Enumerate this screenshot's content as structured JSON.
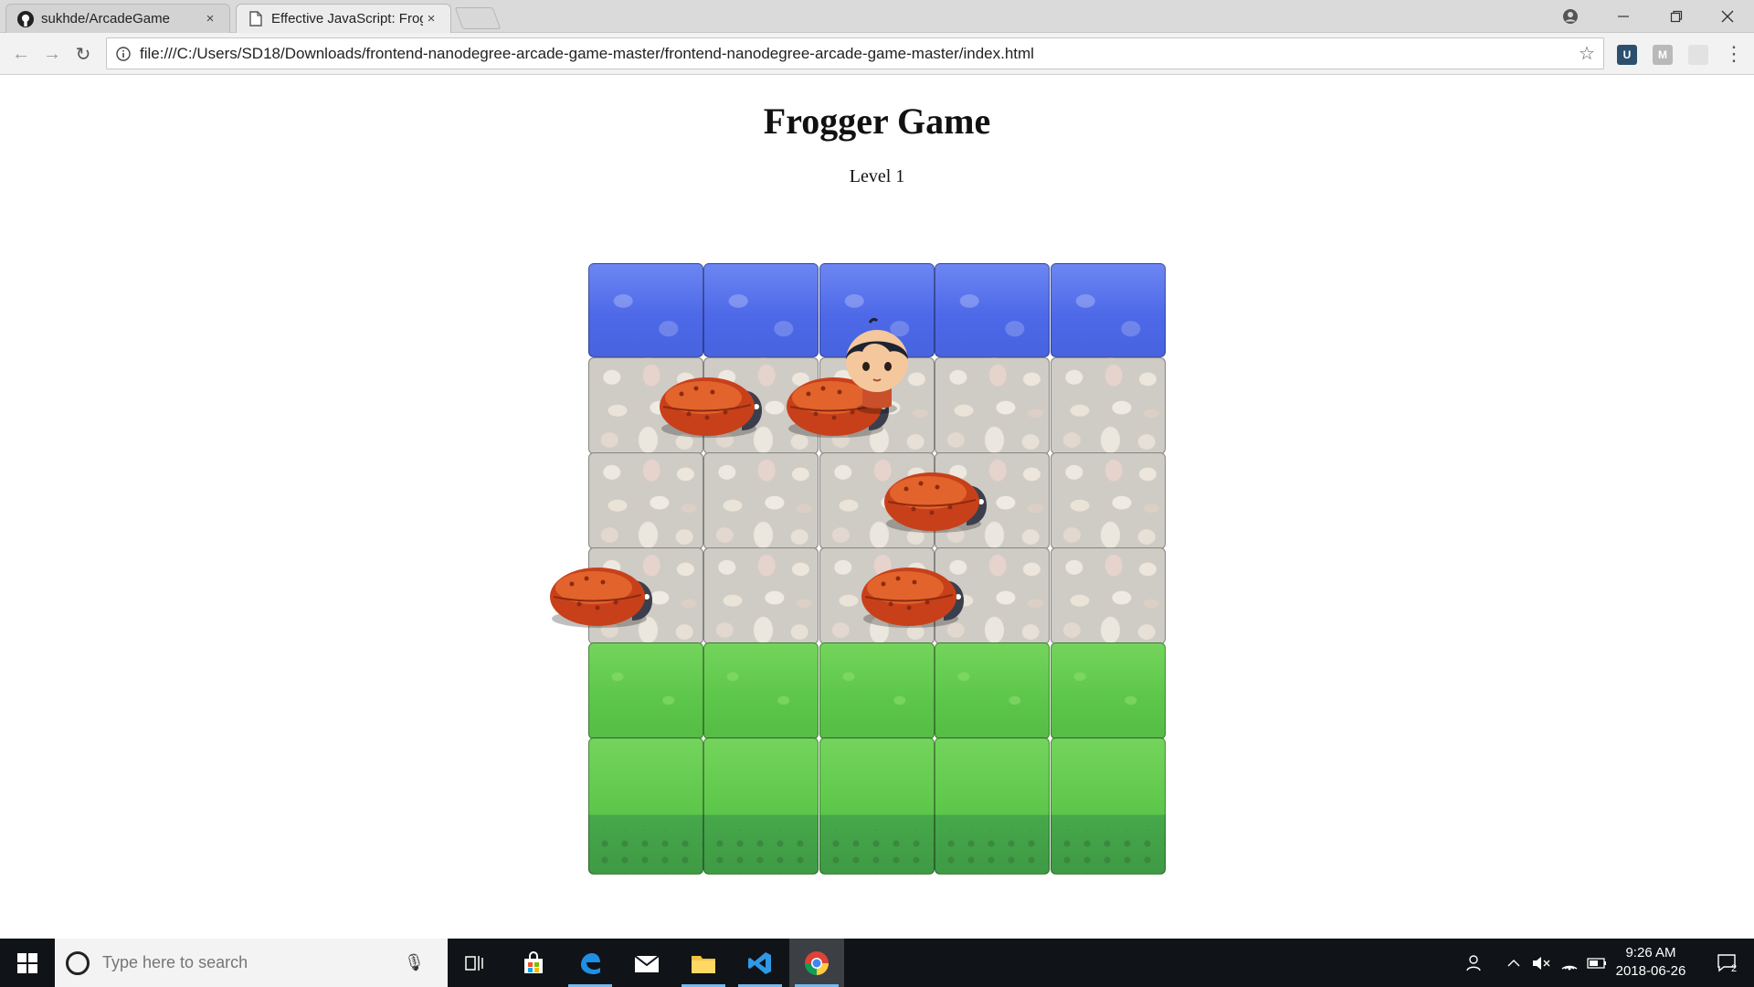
{
  "browser": {
    "tabs": [
      {
        "title": "sukhde/ArcadeGame",
        "icon": "github-icon"
      },
      {
        "title": "Effective JavaScript: Frogger",
        "icon": "page-icon"
      }
    ],
    "close_glyph": "×",
    "url": "file:///C:/Users/SD18/Downloads/frontend-nanodegree-arcade-game-master/frontend-nanodegree-arcade-game-master/index.html"
  },
  "page": {
    "title": "Frogger Game",
    "level": "Level 1"
  },
  "game": {
    "columns": 5,
    "rows": [
      "water",
      "stone",
      "stone",
      "stone",
      "grass",
      "grass"
    ],
    "enemies": [
      {
        "row": 1,
        "col": 0.6
      },
      {
        "row": 1,
        "col": 1.7
      },
      {
        "row": 2,
        "col": 2.55
      },
      {
        "row": 3,
        "col": -0.35
      },
      {
        "row": 3,
        "col": 2.35
      }
    ],
    "player": {
      "row": 1,
      "col": 2,
      "character": "char-boy"
    },
    "colors": {
      "water": "#4e69e8",
      "stone": "#cfcbc5",
      "grass": "#5cc64a",
      "bug": "#c8401a"
    }
  },
  "taskbar": {
    "search_placeholder": "Type here to search",
    "time": "9:26 AM",
    "date": "2018-06-26",
    "notifications": "2"
  }
}
